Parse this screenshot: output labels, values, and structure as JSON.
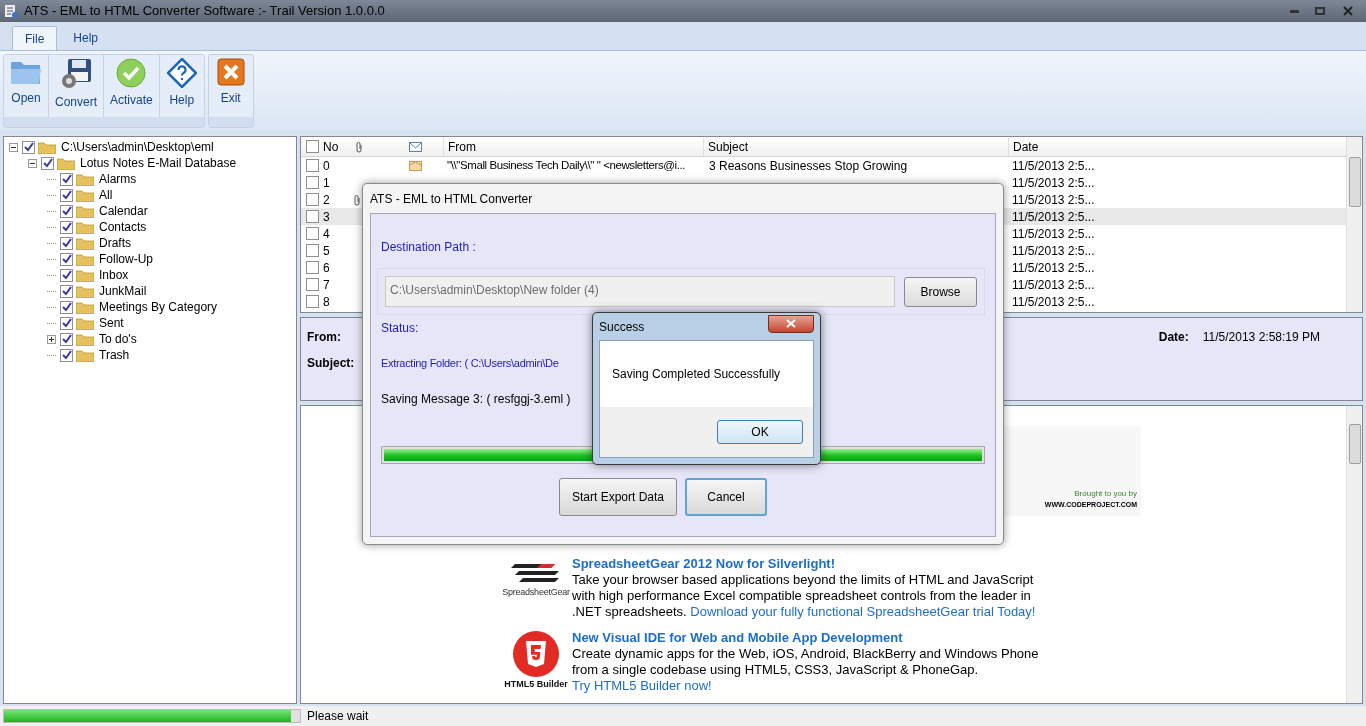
{
  "window": {
    "title": "ATS - EML to HTML Converter Software :- Trail Version 1.0.0.0"
  },
  "tabs": [
    {
      "label": "File",
      "selected": true
    },
    {
      "label": "Help",
      "selected": false
    }
  ],
  "ribbon": {
    "groups": [
      [
        {
          "label": "Open",
          "kind": "open"
        },
        {
          "label": "Convert",
          "kind": "convert"
        },
        {
          "label": "Activate",
          "kind": "activate"
        },
        {
          "label": "Help",
          "kind": "help"
        }
      ],
      [
        {
          "label": "Exit",
          "kind": "exit"
        }
      ]
    ]
  },
  "tree": [
    {
      "label": "C:\\Users\\admin\\Desktop\\eml",
      "checked": true,
      "expanded": true,
      "children": [
        {
          "label": "Lotus Notes E-Mail Database",
          "checked": true,
          "expanded": true,
          "children": [
            {
              "label": "Alarms",
              "checked": true
            },
            {
              "label": "All",
              "checked": true
            },
            {
              "label": "Calendar",
              "checked": true
            },
            {
              "label": "Contacts",
              "checked": true
            },
            {
              "label": "Drafts",
              "checked": true
            },
            {
              "label": "Follow-Up",
              "checked": true
            },
            {
              "label": "Inbox",
              "checked": true
            },
            {
              "label": "JunkMail",
              "checked": true
            },
            {
              "label": "Meetings By Category",
              "checked": true
            },
            {
              "label": "Sent",
              "checked": true
            },
            {
              "label": "To do's",
              "checked": true,
              "expanded": false,
              "has_children": true
            },
            {
              "label": "Trash",
              "checked": true
            }
          ]
        }
      ]
    }
  ],
  "mail_list": {
    "all_checked": false,
    "columns": [
      "No",
      "From",
      "Subject",
      "Date"
    ],
    "rows": [
      {
        "no": "0",
        "checked": false,
        "selected": false,
        "attachment": false,
        "from": "\"\\\\\"Small Business Tech Daily\\\\\" \" <newsletters@i...",
        "subject": "3 Reasons Businesses Stop Growing",
        "date": "11/5/2013 2:5..."
      },
      {
        "no": "1",
        "checked": false,
        "selected": false,
        "attachment": false,
        "date": "11/5/2013 2:5..."
      },
      {
        "no": "2",
        "checked": false,
        "selected": false,
        "attachment": true,
        "date": "11/5/2013 2:5..."
      },
      {
        "no": "3",
        "checked": false,
        "selected": true,
        "attachment": false,
        "date": "11/5/2013 2:5..."
      },
      {
        "no": "4",
        "checked": false,
        "selected": false,
        "attachment": false,
        "date": "11/5/2013 2:5..."
      },
      {
        "no": "5",
        "checked": false,
        "selected": false,
        "attachment": false,
        "date": "11/5/2013 2:5..."
      },
      {
        "no": "6",
        "checked": false,
        "selected": false,
        "attachment": false,
        "date": "11/5/2013 2:5..."
      },
      {
        "no": "7",
        "checked": false,
        "selected": false,
        "attachment": false,
        "date": "11/5/2013 2:5..."
      },
      {
        "no": "8",
        "checked": false,
        "selected": false,
        "attachment": false,
        "date": "11/5/2013 2:5..."
      }
    ]
  },
  "mail_header": {
    "from_label": "From:",
    "subject_label": "Subject:",
    "date_label": "Date:",
    "date": "11/5/2013 2:58:19 PM"
  },
  "mail_body": {
    "banner": {
      "tagline": "Brought to you by",
      "site": "WWW.CODEPROJECT.COM"
    },
    "ads": [
      {
        "kind": "spreadsheet",
        "logo": "SpreadsheetGear",
        "title": "SpreadsheetGear 2012 Now for Silverlight!",
        "text": "Take your browser based applications beyond the limits of HTML and JavaScript with high performance Excel compatible spreadsheet controls from the leader in .NET spreadsheets.",
        "link": "Download your fully functional SpreadsheetGear trial Today!"
      },
      {
        "kind": "html5",
        "logo": "HTML5 Builder",
        "title": "New Visual IDE for Web and Mobile App Development",
        "text": "Create dynamic apps for the Web, iOS, Android, BlackBerry and Windows Phone from a single codebase using HTML5, CSS3, JavaScript & PhoneGap.",
        "link": "Try HTML5 Builder now!"
      }
    ]
  },
  "status_bar": {
    "level": 0.97,
    "text": "Please wait"
  },
  "converter_dialog": {
    "title": "ATS - EML to HTML Converter",
    "destination_label": "Destination Path :",
    "destination": "C:\\Users\\admin\\Desktop\\New folder (4)",
    "browse": "Browse",
    "status_label": "Status:",
    "extracting": "Extracting Folder: ( C:\\Users\\admin\\De",
    "saving": "Saving Message 3: ( resfggj-3.eml )",
    "level": 1,
    "buttons": [
      "Start Export Data",
      "Cancel"
    ]
  },
  "success_dialog": {
    "title": "Success",
    "message": "Saving Completed Successfully",
    "button": "OK"
  }
}
